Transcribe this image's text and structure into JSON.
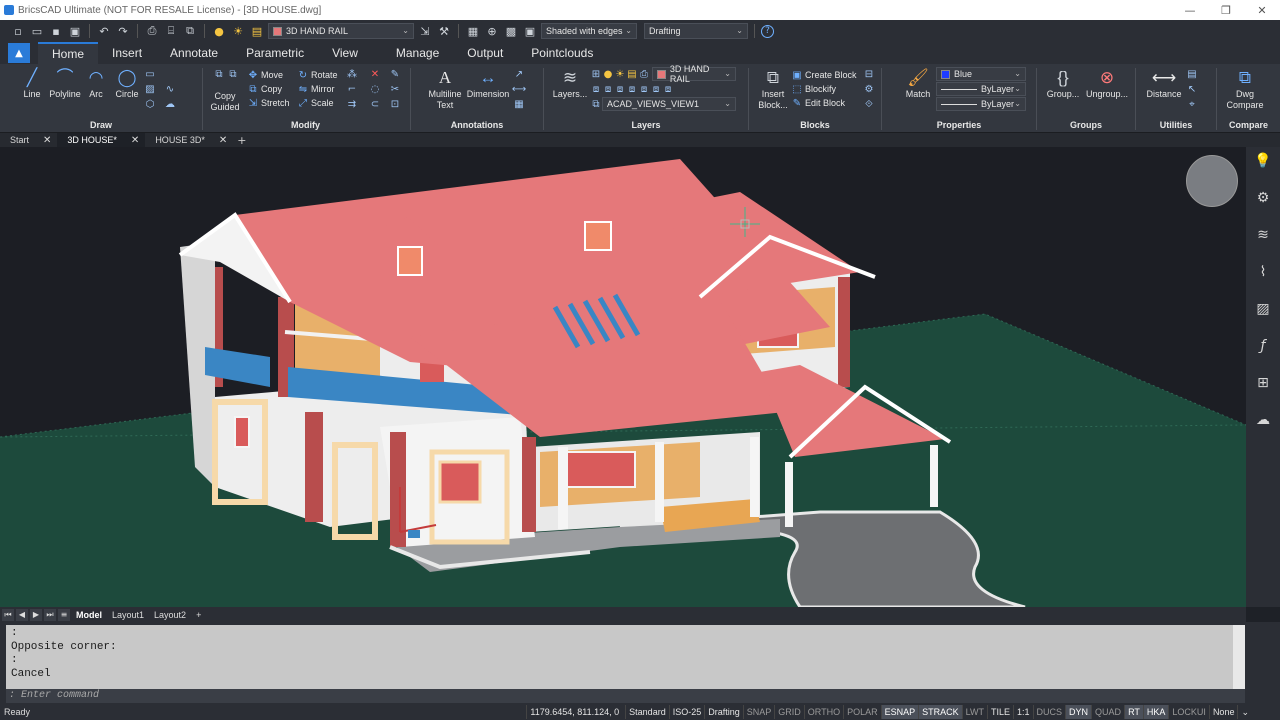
{
  "window": {
    "title": "BricsCAD Ultimate (NOT FOR RESALE License) - [3D HOUSE.dwg]",
    "minimize": "—",
    "restore": "❐",
    "close": "✕"
  },
  "quick_access": {
    "layer_combo": "3D HAND RAIL",
    "visual_style_combo": "Shaded with edges",
    "workspace_combo": "Drafting",
    "help": "?"
  },
  "ribbon_tabs": [
    "Home",
    "Insert",
    "Annotate",
    "Parametric",
    "View",
    "Manage",
    "Output",
    "Pointclouds"
  ],
  "ribbon": {
    "draw": {
      "label": "Draw",
      "line": "Line",
      "polyline": "Polyline",
      "arc": "Arc",
      "circle": "Circle"
    },
    "modify": {
      "label": "Modify",
      "copy_guided_1": "Copy",
      "copy_guided_2": "Guided",
      "move": "Move",
      "copy": "Copy",
      "stretch": "Stretch",
      "rotate": "Rotate",
      "mirror": "Mirror",
      "scale": "Scale"
    },
    "annotations": {
      "label": "Annotations",
      "multiline_1": "Multiline",
      "multiline_2": "Text",
      "dimension": "Dimension"
    },
    "layers": {
      "label": "Layers",
      "layers_btn": "Layers...",
      "layer_current": "3D HAND RAIL",
      "layer_state": "ACAD_VIEWS_VIEW1"
    },
    "blocks": {
      "label": "Blocks",
      "insert_1": "Insert",
      "insert_2": "Block...",
      "create_block": "Create Block",
      "blockify": "Blockify",
      "edit_block": "Edit Block"
    },
    "properties": {
      "label": "Properties",
      "match": "Match",
      "color": "Blue",
      "linetype": "ByLayer",
      "lineweight": "ByLayer"
    },
    "groups": {
      "label": "Groups",
      "group": "Group...",
      "ungroup": "Ungroup..."
    },
    "utilities": {
      "label": "Utilities",
      "distance": "Distance"
    },
    "compare": {
      "label": "Compare",
      "dwg_1": "Dwg",
      "dwg_2": "Compare"
    }
  },
  "doc_tabs": [
    "Start",
    "3D HOUSE*",
    "HOUSE 3D*"
  ],
  "layout_tabs": [
    "Model",
    "Layout1",
    "Layout2"
  ],
  "command": {
    "history": [
      ":",
      "Opposite corner:",
      ":",
      "Cancel"
    ],
    "prompt": ": Enter command"
  },
  "status": {
    "ready": "Ready",
    "coords": "1179.6454, 811.124, 0",
    "text_style": "Standard",
    "dim_style": "ISO-25",
    "workspace": "Drafting",
    "toggles": [
      {
        "label": "SNAP",
        "on": false
      },
      {
        "label": "GRID",
        "on": false
      },
      {
        "label": "ORTHO",
        "on": false
      },
      {
        "label": "POLAR",
        "on": false
      },
      {
        "label": "ESNAP",
        "on": true
      },
      {
        "label": "STRACK",
        "on": true
      },
      {
        "label": "LWT",
        "on": false
      },
      {
        "label": "TILE",
        "on": false
      },
      {
        "label": "1:1",
        "on": false
      },
      {
        "label": "DUCS",
        "on": false
      },
      {
        "label": "DYN",
        "on": true
      },
      {
        "label": "QUAD",
        "on": false
      },
      {
        "label": "RT",
        "on": true
      },
      {
        "label": "HKA",
        "on": true
      },
      {
        "label": "LOCKUI",
        "on": false
      },
      {
        "label": "None",
        "on": false
      }
    ]
  },
  "colors": {
    "accent": "#2a7bd8",
    "roof": "#e5787a",
    "ground": "#1d4a3c",
    "viewport_bg": "#1c1e24",
    "color_swatch_blue": "#1f3cff"
  }
}
